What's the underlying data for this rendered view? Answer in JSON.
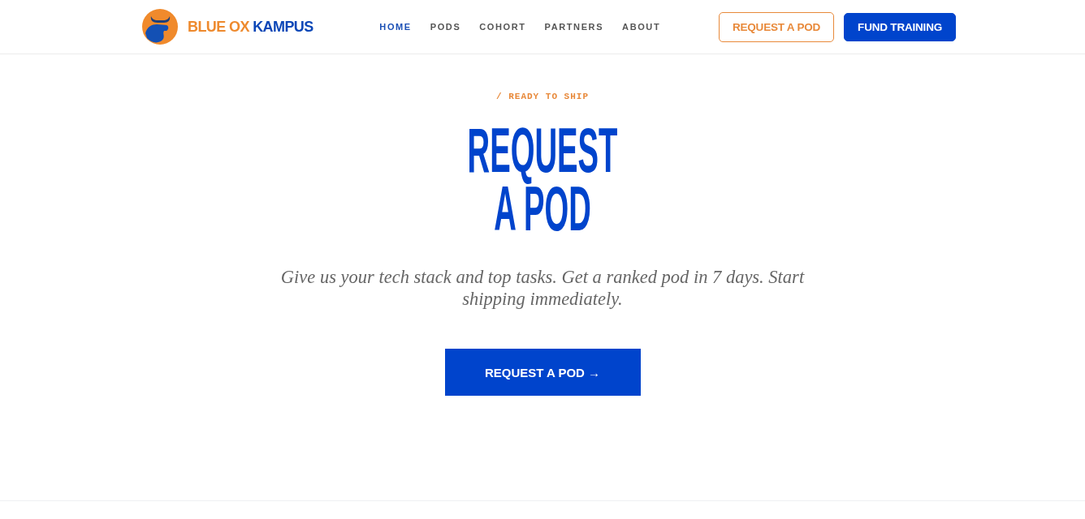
{
  "header": {
    "brand": {
      "name": "BLUE OX",
      "name_accent": "KAMPUS"
    },
    "nav": [
      {
        "label": "HOME",
        "selected": true
      },
      {
        "label": "PODS",
        "selected": false
      },
      {
        "label": "COHORT",
        "selected": false
      },
      {
        "label": "PARTNERS",
        "selected": false
      },
      {
        "label": "ABOUT",
        "selected": false
      }
    ],
    "actions": [
      {
        "label": "REQUEST A POD",
        "kind": "outline"
      },
      {
        "label": "FUND TRAINING",
        "kind": "solid"
      }
    ]
  },
  "hero": {
    "eyebrow": "/ READY TO SHIP",
    "title": "REQUEST A POD",
    "subtitle": "Give us your tech stack and top tasks. Get a ranked pod in 7 days. Start shipping immediately.",
    "cta": "REQUEST A POD →"
  }
}
